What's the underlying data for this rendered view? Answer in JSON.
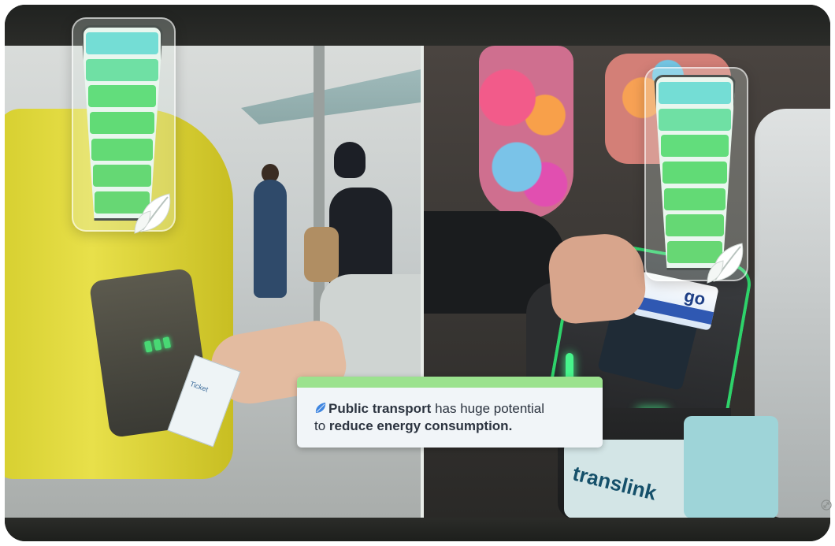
{
  "caption": {
    "icon": "blue-leaf-icon",
    "part1_bold": "Public transport",
    "part2": " has huge potential",
    "part3": "to ",
    "part4_bold": "reduce energy consumption."
  },
  "left_scene": {
    "ticket_text": "Ticket"
  },
  "right_scene": {
    "card_text": "go",
    "brand_text": "translink"
  },
  "gauges": {
    "left_level_segments": 7,
    "right_level_segments": 7,
    "icon": "leaf-icon"
  },
  "colors": {
    "caption_accent": "#9be28e",
    "gauge_green": "#62dd7c",
    "gauge_teal": "#74ddd5",
    "gate_glow": "#47f58c"
  }
}
